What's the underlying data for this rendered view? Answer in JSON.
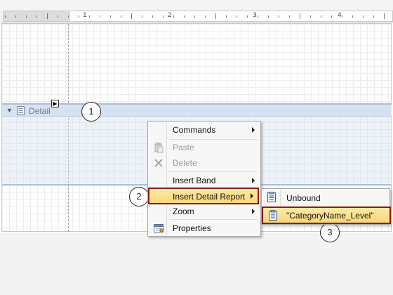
{
  "ruler": {
    "numbers": [
      "1",
      "2",
      "3",
      "4"
    ]
  },
  "band": {
    "label": "Detail",
    "smart_tag": "▶"
  },
  "context_menu": {
    "items": [
      {
        "label": "Commands",
        "has_submenu": true,
        "disabled": false,
        "icon": ""
      },
      {
        "label": "Paste",
        "has_submenu": false,
        "disabled": true,
        "icon": "paste-icon"
      },
      {
        "label": "Delete",
        "has_submenu": false,
        "disabled": true,
        "icon": "delete-icon"
      },
      {
        "label": "Insert Band",
        "has_submenu": true,
        "disabled": false,
        "icon": ""
      },
      {
        "label": "Insert Detail Report",
        "has_submenu": true,
        "disabled": false,
        "icon": "",
        "highlighted": true
      },
      {
        "label": "Zoom",
        "has_submenu": true,
        "disabled": false,
        "icon": ""
      },
      {
        "label": "Properties",
        "has_submenu": false,
        "disabled": false,
        "icon": "properties-icon"
      }
    ]
  },
  "submenu": {
    "items": [
      {
        "label": "Unbound",
        "icon": "report-icon"
      },
      {
        "label": "\"CategoryName_Level\"",
        "icon": "report-icon",
        "highlighted": true
      }
    ]
  },
  "callouts": {
    "c1": "1",
    "c2": "2",
    "c3": "3"
  },
  "colors": {
    "highlight": "#f9d776",
    "highlight_border": "#8b1a1a",
    "band": "#d6e2f2"
  }
}
